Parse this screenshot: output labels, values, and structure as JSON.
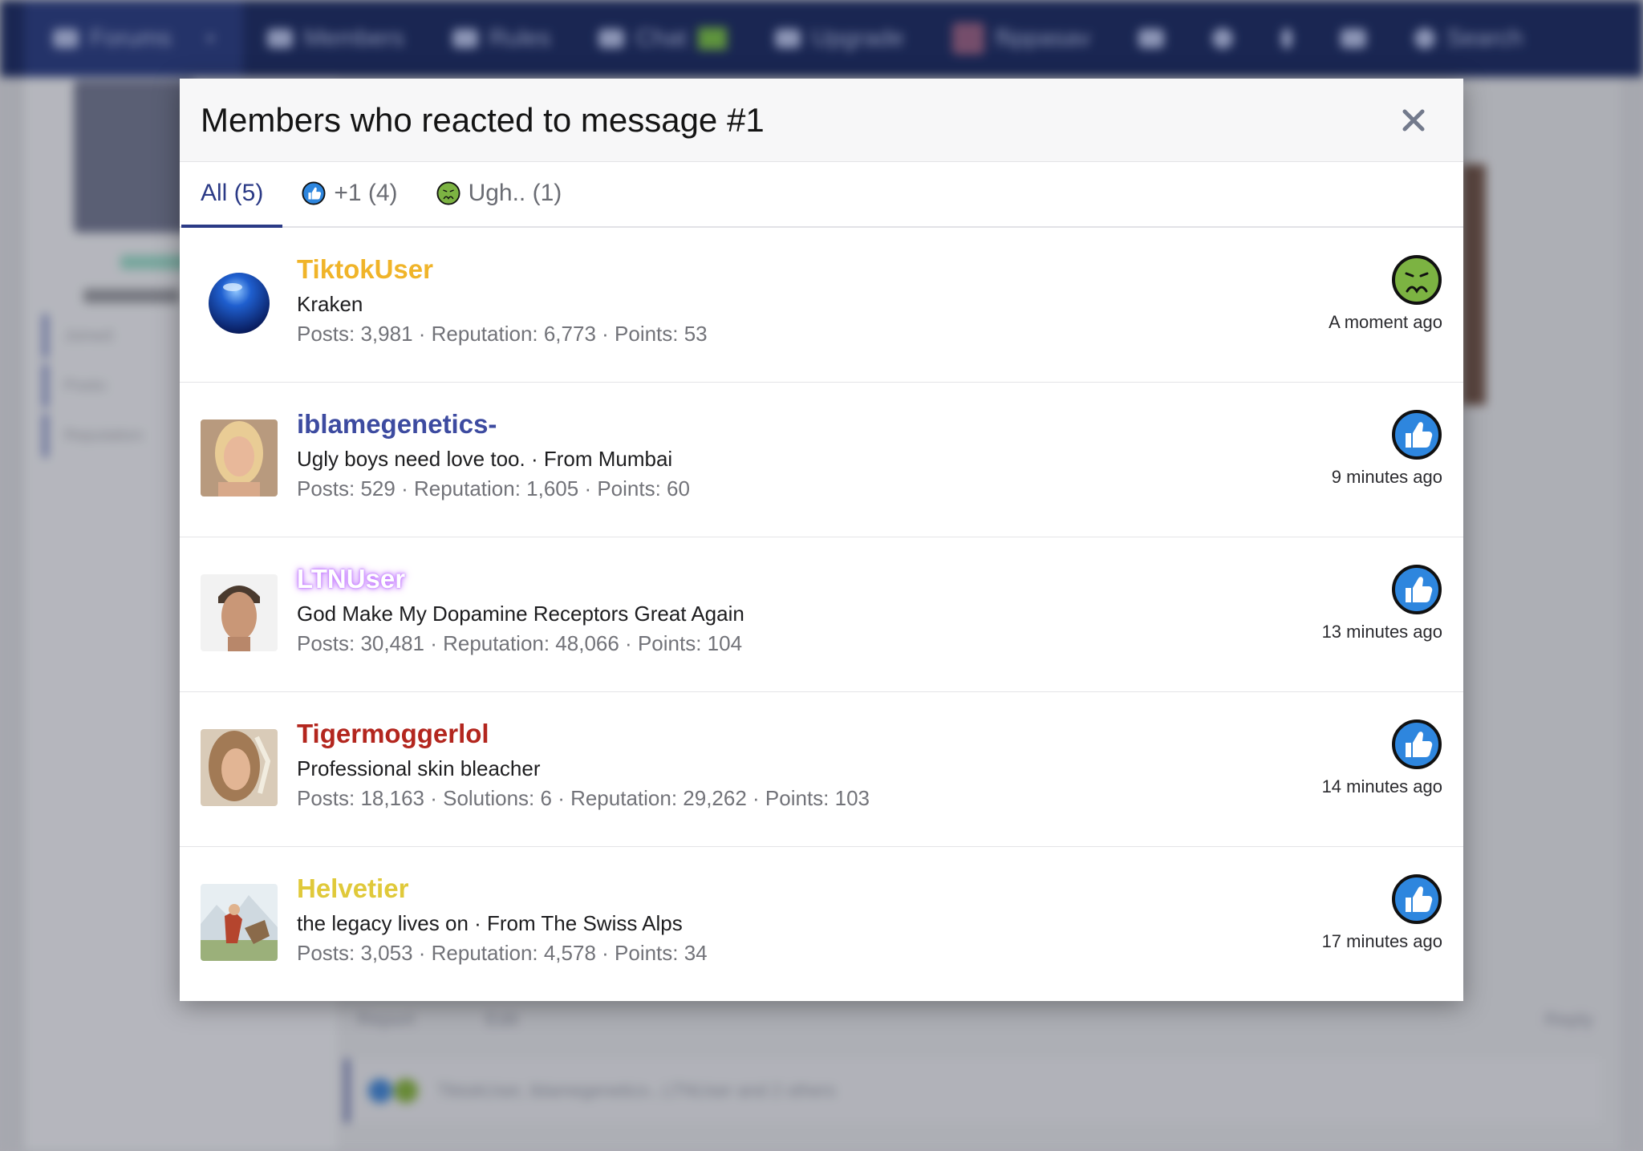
{
  "colors": {
    "tab_active": "#2b3a86",
    "name_tiktokuser": "#f0b429",
    "name_iblamegenetics": "#3d4ba0",
    "name_ltnuser": "#ffffff",
    "name_ltnuser_glow": "#c77dff",
    "name_tigermoggerlol": "#b3261e",
    "name_helvetier": "#e0c93a",
    "react_like": "#2e86de",
    "react_ugh": "#7cb342"
  },
  "modal": {
    "title": "Members who reacted to message #1",
    "close_icon": "close-icon",
    "tabs": [
      {
        "label": "All (5)",
        "icon": ""
      },
      {
        "label": "+1 (4)",
        "icon": "thumbs-up-icon"
      },
      {
        "label": "Ugh.. (1)",
        "icon": "nauseated-face-icon"
      }
    ],
    "members": [
      {
        "name": "TiktokUser",
        "title": "Kraken",
        "stats": "Posts: 3,981 · Reputation: 6,773 · Points: 53",
        "reaction": "nauseated-face-icon",
        "time": "A moment ago"
      },
      {
        "name": "iblamegenetics-",
        "title": "Ugly boys need love too. · From Mumbai",
        "stats": "Posts: 529 · Reputation: 1,605 · Points: 60",
        "reaction": "thumbs-up-icon",
        "time": "9 minutes ago"
      },
      {
        "name": "LTNUser",
        "title": "God Make My Dopamine Receptors Great Again",
        "stats": "Posts: 30,481 · Reputation: 48,066 · Points: 104",
        "reaction": "thumbs-up-icon",
        "time": "13 minutes ago"
      },
      {
        "name": "Tigermoggerlol",
        "title": "Professional skin bleacher",
        "stats": "Posts: 18,163 · Solutions: 6 · Reputation: 29,262 · Points: 103",
        "reaction": "thumbs-up-icon",
        "time": "14 minutes ago"
      },
      {
        "name": "Helvetier",
        "title": "the legacy lives on · From The Swiss Alps",
        "stats": "Posts: 3,053 · Reputation: 4,578 · Points: 34",
        "reaction": "thumbs-up-icon",
        "time": "17 minutes ago"
      }
    ]
  },
  "background": {
    "nav": [
      {
        "label": "Forums",
        "icon": "comments-icon"
      },
      {
        "label": "Members",
        "icon": "users-icon"
      },
      {
        "label": "Rules",
        "icon": "rules-icon"
      },
      {
        "label": "Chat",
        "icon": "chat-icon"
      },
      {
        "label": "Upgrade",
        "icon": "upgrade-icon"
      },
      {
        "label": "flippasav",
        "icon": "avatar"
      },
      {
        "label": "Search",
        "icon": "search-icon"
      }
    ],
    "sidebar_labels": [
      "Joined:",
      "Posts:",
      "Reputation:"
    ],
    "actions": {
      "report": "Report",
      "edit": "Edit",
      "reply": "Reply"
    },
    "reaction_summary": "TiktokUser, iblamegenetics-, LTNUser and 2 others"
  }
}
